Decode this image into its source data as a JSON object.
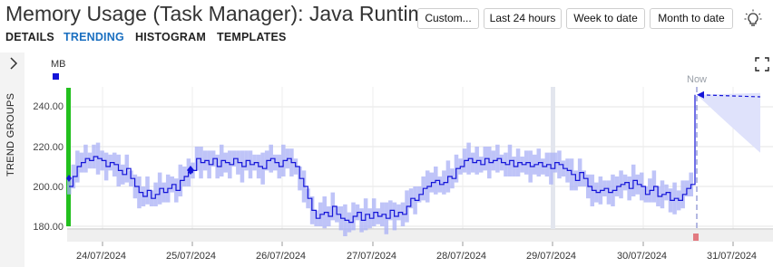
{
  "header": {
    "title": "Memory Usage (Task Manager): Java Runtime",
    "buttons": {
      "custom": "Custom...",
      "last24": "Last 24 hours",
      "week": "Week to date",
      "month": "Month to date"
    },
    "tabs": [
      "DETAILS",
      "TRENDING",
      "HISTOGRAM",
      "TEMPLATES"
    ],
    "active_tab": "TRENDING"
  },
  "sidebar": {
    "label": "TREND GROUPS"
  },
  "chart_data": {
    "type": "line",
    "units": "MB",
    "now_label": "Now",
    "y_ticks": [
      "240.00",
      "220.00",
      "200.00",
      "180.00"
    ],
    "ylim": [
      176,
      250
    ],
    "x_ticks": [
      "24/07/2024",
      "25/07/2024",
      "26/07/2024",
      "27/07/2024",
      "28/07/2024",
      "29/07/2024",
      "30/07/2024",
      "31/07/2024"
    ],
    "series_color": "#1414d8",
    "band_color": "#aab0f5",
    "x_start": "2024-07-23 12:00",
    "x_end": "2024-07-31 12:00",
    "series": [
      {
        "values_mb": [
          200,
          205,
          210,
          212,
          214,
          213,
          215,
          214,
          213,
          210,
          212,
          211,
          208,
          206,
          209,
          204,
          200,
          197,
          195,
          198,
          194,
          196,
          199,
          197,
          199,
          201,
          198,
          203,
          205,
          207,
          208,
          214,
          212,
          213,
          211,
          214,
          210,
          213,
          212,
          211,
          214,
          212,
          210,
          213,
          211,
          212,
          210,
          209,
          213,
          214,
          212,
          210,
          213,
          214,
          212,
          210,
          204,
          200,
          194,
          188,
          184,
          186,
          187,
          185,
          190,
          186,
          184,
          183,
          182,
          185,
          187,
          183,
          186,
          184,
          187,
          185,
          186,
          184,
          188,
          185,
          187,
          186,
          190,
          194,
          193,
          196,
          199,
          200,
          202,
          203,
          201,
          202,
          205,
          204,
          209,
          210,
          213,
          214,
          212,
          213,
          211,
          214,
          212,
          213,
          214,
          212,
          211,
          213,
          210,
          212,
          211,
          212,
          210,
          211,
          212,
          210,
          211,
          209,
          212,
          211,
          209,
          208,
          206,
          203,
          207,
          204,
          200,
          198,
          197,
          198,
          199,
          197,
          198,
          200,
          201,
          202,
          199,
          203,
          201,
          200,
          196,
          198,
          200,
          195,
          196,
          197,
          193,
          194,
          193,
          196,
          199,
          201,
          246
        ]
      }
    ],
    "forecast": {
      "start_mb": 246,
      "end_mb": 245
    }
  }
}
